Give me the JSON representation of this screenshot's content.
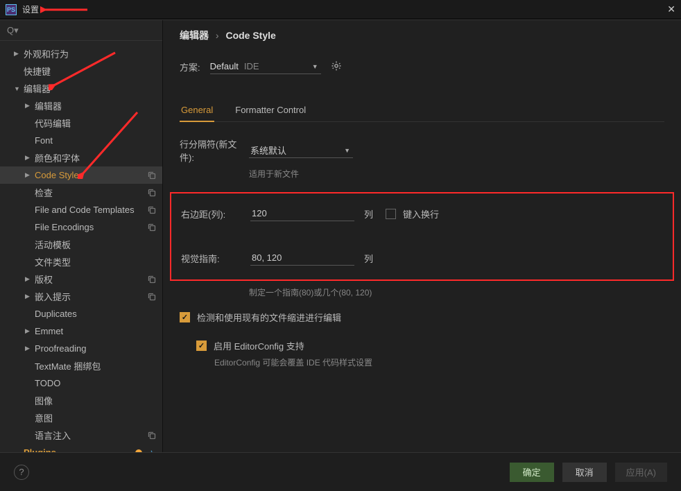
{
  "titlebar": {
    "app": "PS",
    "title": "设置"
  },
  "sidebar": {
    "search_placeholder": "",
    "items": [
      {
        "label": "外观和行为",
        "caret": "right",
        "depth": 1
      },
      {
        "label": "快捷键",
        "caret": "none",
        "depth": 1
      },
      {
        "label": "编辑器",
        "caret": "down",
        "depth": 1
      },
      {
        "label": "编辑器",
        "caret": "right",
        "depth": 2
      },
      {
        "label": "代码编辑",
        "caret": "none",
        "depth": 2
      },
      {
        "label": "Font",
        "caret": "none",
        "depth": 2
      },
      {
        "label": "颜色和字体",
        "caret": "right",
        "depth": 2
      },
      {
        "label": "Code Style",
        "caret": "right",
        "depth": 2,
        "selected": true,
        "copy": true,
        "accent": true
      },
      {
        "label": "检查",
        "caret": "none",
        "depth": 2,
        "copy": true
      },
      {
        "label": "File and Code Templates",
        "caret": "none",
        "depth": 2,
        "copy": true
      },
      {
        "label": "File Encodings",
        "caret": "none",
        "depth": 2,
        "copy": true
      },
      {
        "label": "活动模板",
        "caret": "none",
        "depth": 2
      },
      {
        "label": "文件类型",
        "caret": "none",
        "depth": 2
      },
      {
        "label": "版权",
        "caret": "right",
        "depth": 2,
        "copy": true
      },
      {
        "label": "嵌入提示",
        "caret": "right",
        "depth": 2,
        "copy": true
      },
      {
        "label": "Duplicates",
        "caret": "none",
        "depth": 2
      },
      {
        "label": "Emmet",
        "caret": "right",
        "depth": 2
      },
      {
        "label": "Proofreading",
        "caret": "right",
        "depth": 2
      },
      {
        "label": "TextMate 捆绑包",
        "caret": "none",
        "depth": 2
      },
      {
        "label": "TODO",
        "caret": "none",
        "depth": 2
      },
      {
        "label": "图像",
        "caret": "none",
        "depth": 2
      },
      {
        "label": "意图",
        "caret": "none",
        "depth": 2
      },
      {
        "label": "语言注入",
        "caret": "none",
        "depth": 2,
        "copy": true
      },
      {
        "label": "Plugins",
        "caret": "none",
        "depth": 1,
        "plugins": true,
        "badge": true
      }
    ]
  },
  "main": {
    "breadcrumb": {
      "a": "编辑器",
      "b": "Code Style"
    },
    "scheme_label": "方案:",
    "scheme_value": "Default",
    "scheme_suffix": "IDE",
    "tabs": {
      "general": "General",
      "formatter": "Formatter Control"
    },
    "line_sep": {
      "label": "行分隔符(新文件):",
      "value": "系统默认",
      "hint": "适用于新文件"
    },
    "right_margin": {
      "label": "右边距(列):",
      "value": "120",
      "unit": "列"
    },
    "wrap": {
      "label": "键入换行"
    },
    "visual_guides": {
      "label": "视觉指南:",
      "value": "80, 120",
      "unit": "列",
      "hint": "制定一个指南(80)或几个(80, 120)"
    },
    "detect_indent": {
      "label": "检测和使用现有的文件缩进进行编辑"
    },
    "editorconfig": {
      "label": "启用 EditorConfig 支持",
      "hint": "EditorConfig 可能会覆盖 IDE 代码样式设置"
    }
  },
  "footer": {
    "ok": "确定",
    "cancel": "取消",
    "apply": "应用(A)"
  }
}
